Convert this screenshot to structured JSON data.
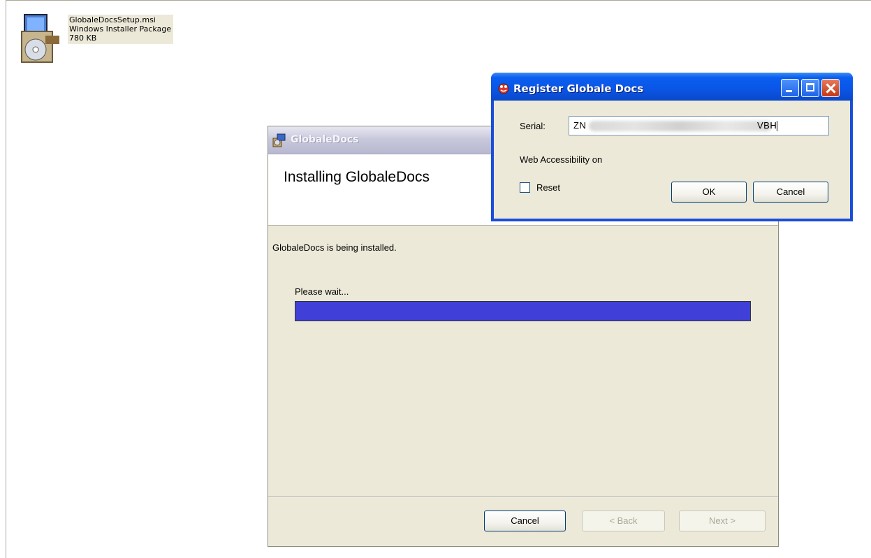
{
  "desktop_file": {
    "name": "GlobaleDocsSetup.msi",
    "type": "Windows Installer Package",
    "size": "780 KB"
  },
  "installer": {
    "title": "GlobaleDocs",
    "heading": "Installing GlobaleDocs",
    "status": "GlobaleDocs is being installed.",
    "wait": "Please wait...",
    "progress_percent": 100,
    "buttons": {
      "cancel": "Cancel",
      "back": "< Back",
      "next": "Next >"
    }
  },
  "register_dialog": {
    "title": "Register Globale Docs",
    "serial_label": "Serial:",
    "serial_prefix": "ZN",
    "serial_suffix": "VBH",
    "web_accessibility": "Web Accessibility on",
    "reset_label": "Reset",
    "reset_checked": false,
    "ok": "OK",
    "cancel": "Cancel"
  },
  "colors": {
    "progress": "#4040d8",
    "xp_titlebar": "#0a55e6",
    "dialog_face": "#ece9d8"
  }
}
